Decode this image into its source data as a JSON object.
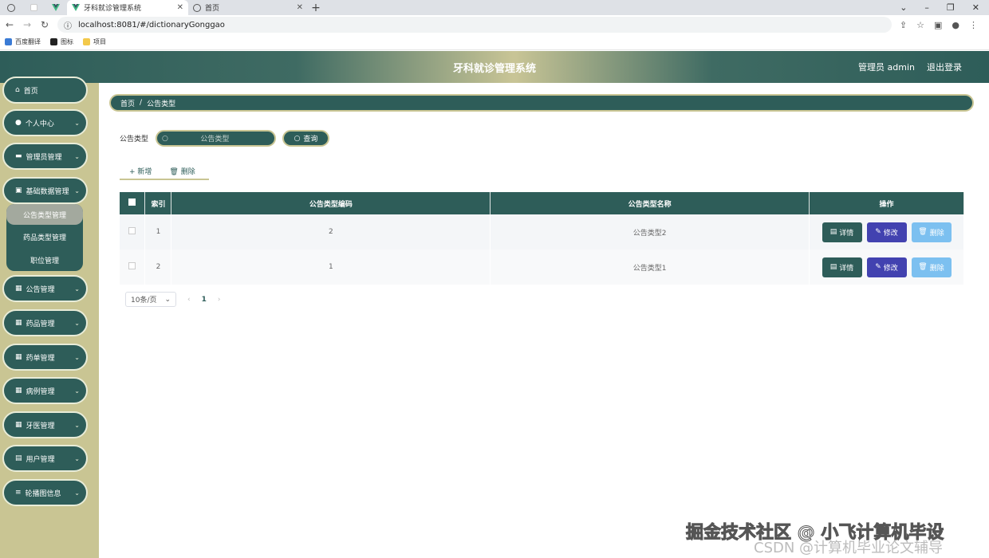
{
  "browser": {
    "active_tab_title": "牙科就诊管理系统",
    "inactive_tab_title": "首页",
    "url": "localhost:8081/#/dictionaryGonggao",
    "bookmarks": [
      "百度翻译",
      "图标",
      "项目"
    ]
  },
  "header": {
    "title": "牙科就诊管理系统",
    "user": "管理员 admin",
    "logout": "退出登录"
  },
  "sidebar": {
    "items": [
      {
        "label": "首页"
      },
      {
        "label": "个人中心"
      },
      {
        "label": "管理员管理"
      },
      {
        "label": "基础数据管理"
      },
      {
        "label": "公告管理"
      },
      {
        "label": "药品管理"
      },
      {
        "label": "药单管理"
      },
      {
        "label": "病例管理"
      },
      {
        "label": "牙医管理"
      },
      {
        "label": "用户管理"
      },
      {
        "label": "轮播图信息"
      }
    ],
    "submenu": [
      "公告类型管理",
      "药品类型管理",
      "职位管理"
    ]
  },
  "breadcrumb": {
    "home": "首页",
    "sep": "/",
    "current": "公告类型"
  },
  "search": {
    "label": "公告类型",
    "placeholder": "公告类型",
    "query_button": "查询"
  },
  "actions": {
    "add": "新增",
    "delete": "删除"
  },
  "table": {
    "headers": [
      "索引",
      "公告类型编码",
      "公告类型名称",
      "操作"
    ],
    "rows": [
      {
        "index": "1",
        "code": "2",
        "name": "公告类型2"
      },
      {
        "index": "2",
        "code": "1",
        "name": "公告类型1"
      }
    ],
    "buttons": {
      "detail": "详情",
      "edit": "修改",
      "delete": "删除"
    }
  },
  "pagination": {
    "page_size": "10条/页",
    "current_page": "1"
  },
  "watermark": {
    "line1": "掘金技术社区 @ 小飞计算机毕设",
    "line2": "CSDN @计算机毕业论文辅导"
  },
  "colors": {
    "primary": "#2e5d59",
    "accent": "#c9c593",
    "edit": "#4242b0",
    "delete": "#7cc0f0"
  }
}
